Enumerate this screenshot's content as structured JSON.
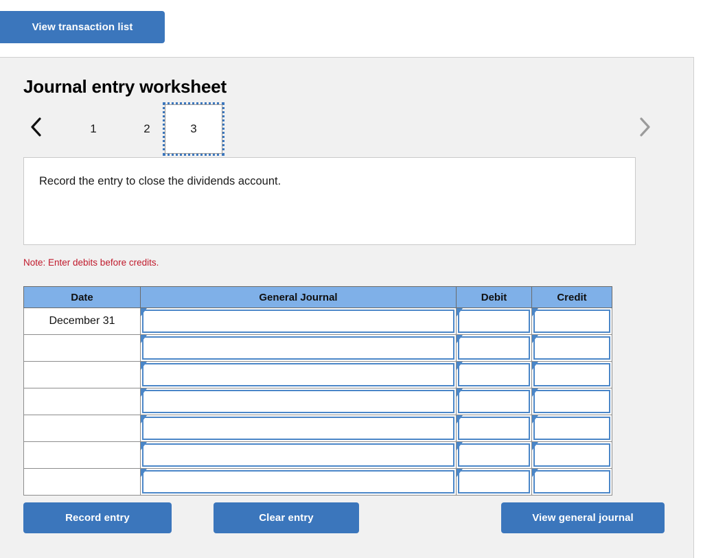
{
  "toolbar": {
    "view_transaction_list_label": "View transaction list"
  },
  "worksheet": {
    "title": "Journal entry worksheet",
    "pager": {
      "prev_icon": "chevron-left-icon",
      "next_icon": "chevron-right-icon",
      "tabs": [
        "1",
        "2",
        "3"
      ],
      "active_tab": "3"
    },
    "instruction": "Record the entry to close the dividends account.",
    "note": "Note: Enter debits before credits."
  },
  "journal_table": {
    "columns": [
      "Date",
      "General Journal",
      "Debit",
      "Credit"
    ],
    "rows": [
      {
        "date": "December 31",
        "general_journal": "",
        "debit": "",
        "credit": ""
      },
      {
        "date": "",
        "general_journal": "",
        "debit": "",
        "credit": ""
      },
      {
        "date": "",
        "general_journal": "",
        "debit": "",
        "credit": ""
      },
      {
        "date": "",
        "general_journal": "",
        "debit": "",
        "credit": ""
      },
      {
        "date": "",
        "general_journal": "",
        "debit": "",
        "credit": ""
      },
      {
        "date": "",
        "general_journal": "",
        "debit": "",
        "credit": ""
      },
      {
        "date": "",
        "general_journal": "",
        "debit": "",
        "credit": ""
      }
    ]
  },
  "actions": {
    "record_entry_label": "Record entry",
    "clear_entry_label": "Clear entry",
    "view_general_journal_label": "View general journal"
  },
  "colors": {
    "button_blue": "#3b76bc",
    "table_header_blue": "#7fb0e8",
    "input_border_blue": "#4a86c8",
    "note_red": "#c0192b",
    "panel_gray": "#f1f1f1"
  }
}
